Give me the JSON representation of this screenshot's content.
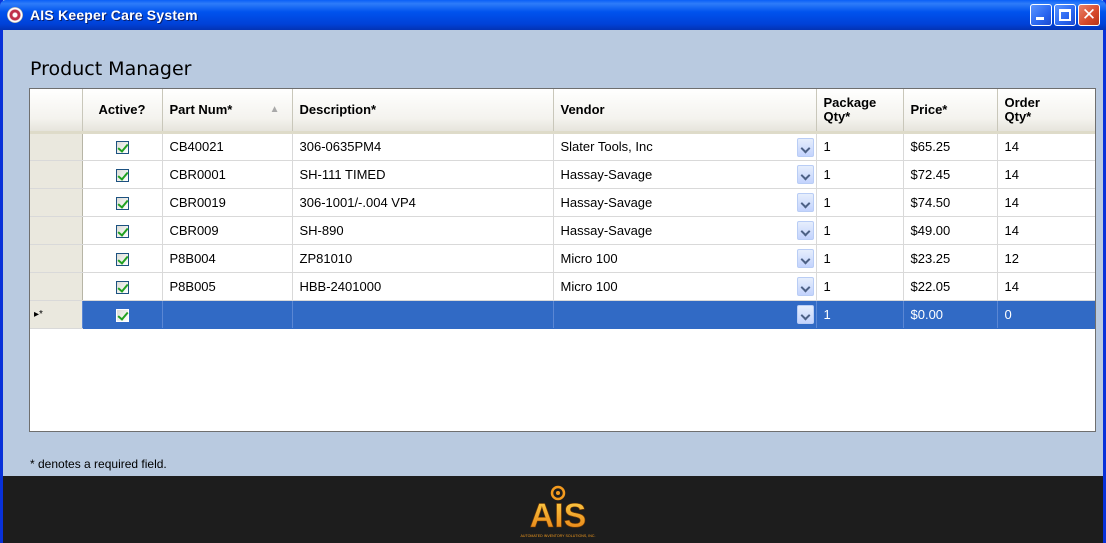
{
  "window": {
    "title": "AIS Keeper Care System"
  },
  "page": {
    "title": "Product Manager",
    "footnote": "* denotes a required field."
  },
  "columns": {
    "active": "Active?",
    "part_num": "Part Num*",
    "description": "Description*",
    "vendor": "Vendor",
    "package_qty_line1": "Package",
    "package_qty_line2": "Qty*",
    "price": "Price*",
    "order_qty_line1": "Order",
    "order_qty_line2": "Qty*"
  },
  "rows": [
    {
      "active": true,
      "part_num": "CB40021",
      "description": "306-0635PM4",
      "vendor": "Slater Tools, Inc",
      "package_qty": "1",
      "price": "$65.25",
      "order_qty": "14"
    },
    {
      "active": true,
      "part_num": "CBR0001",
      "description": "SH-111 TIMED",
      "vendor": "Hassay-Savage",
      "package_qty": "1",
      "price": "$72.45",
      "order_qty": "14"
    },
    {
      "active": true,
      "part_num": "CBR0019",
      "description": "306-1001/-.004 VP4",
      "vendor": "Hassay-Savage",
      "package_qty": "1",
      "price": "$74.50",
      "order_qty": "14"
    },
    {
      "active": true,
      "part_num": "CBR009",
      "description": "SH-890",
      "vendor": "Hassay-Savage",
      "package_qty": "1",
      "price": "$49.00",
      "order_qty": "14"
    },
    {
      "active": true,
      "part_num": "P8B004",
      "description": "ZP81010",
      "vendor": "Micro 100",
      "package_qty": "1",
      "price": "$23.25",
      "order_qty": "12"
    },
    {
      "active": true,
      "part_num": "P8B005",
      "description": "HBB-2401000",
      "vendor": "Micro 100",
      "package_qty": "1",
      "price": "$22.05",
      "order_qty": "14"
    }
  ],
  "new_row": {
    "indicator": "▸*",
    "active": true,
    "part_num": "",
    "description": "",
    "vendor": "",
    "package_qty": "1",
    "price": "$0.00",
    "order_qty": "0"
  },
  "footer": {
    "logo_text": "AIS",
    "logo_tagline": "AUTOMATED INVENTORY SOLUTIONS, INC."
  },
  "colors": {
    "titlebar": "#0053ee",
    "selection": "#316ac5",
    "window_bg": "#b9cae0",
    "footer_bg": "#1d1d1d",
    "logo_orange": "#f39a1e"
  },
  "icons": {
    "title_icon": "app-target-icon",
    "minimize": "minimize-icon",
    "maximize": "maximize-icon",
    "close": "close-icon",
    "sort": "sort-ascending-icon",
    "dropdown": "chevron-down-icon",
    "checkbox": "checkbox-checked-icon"
  }
}
